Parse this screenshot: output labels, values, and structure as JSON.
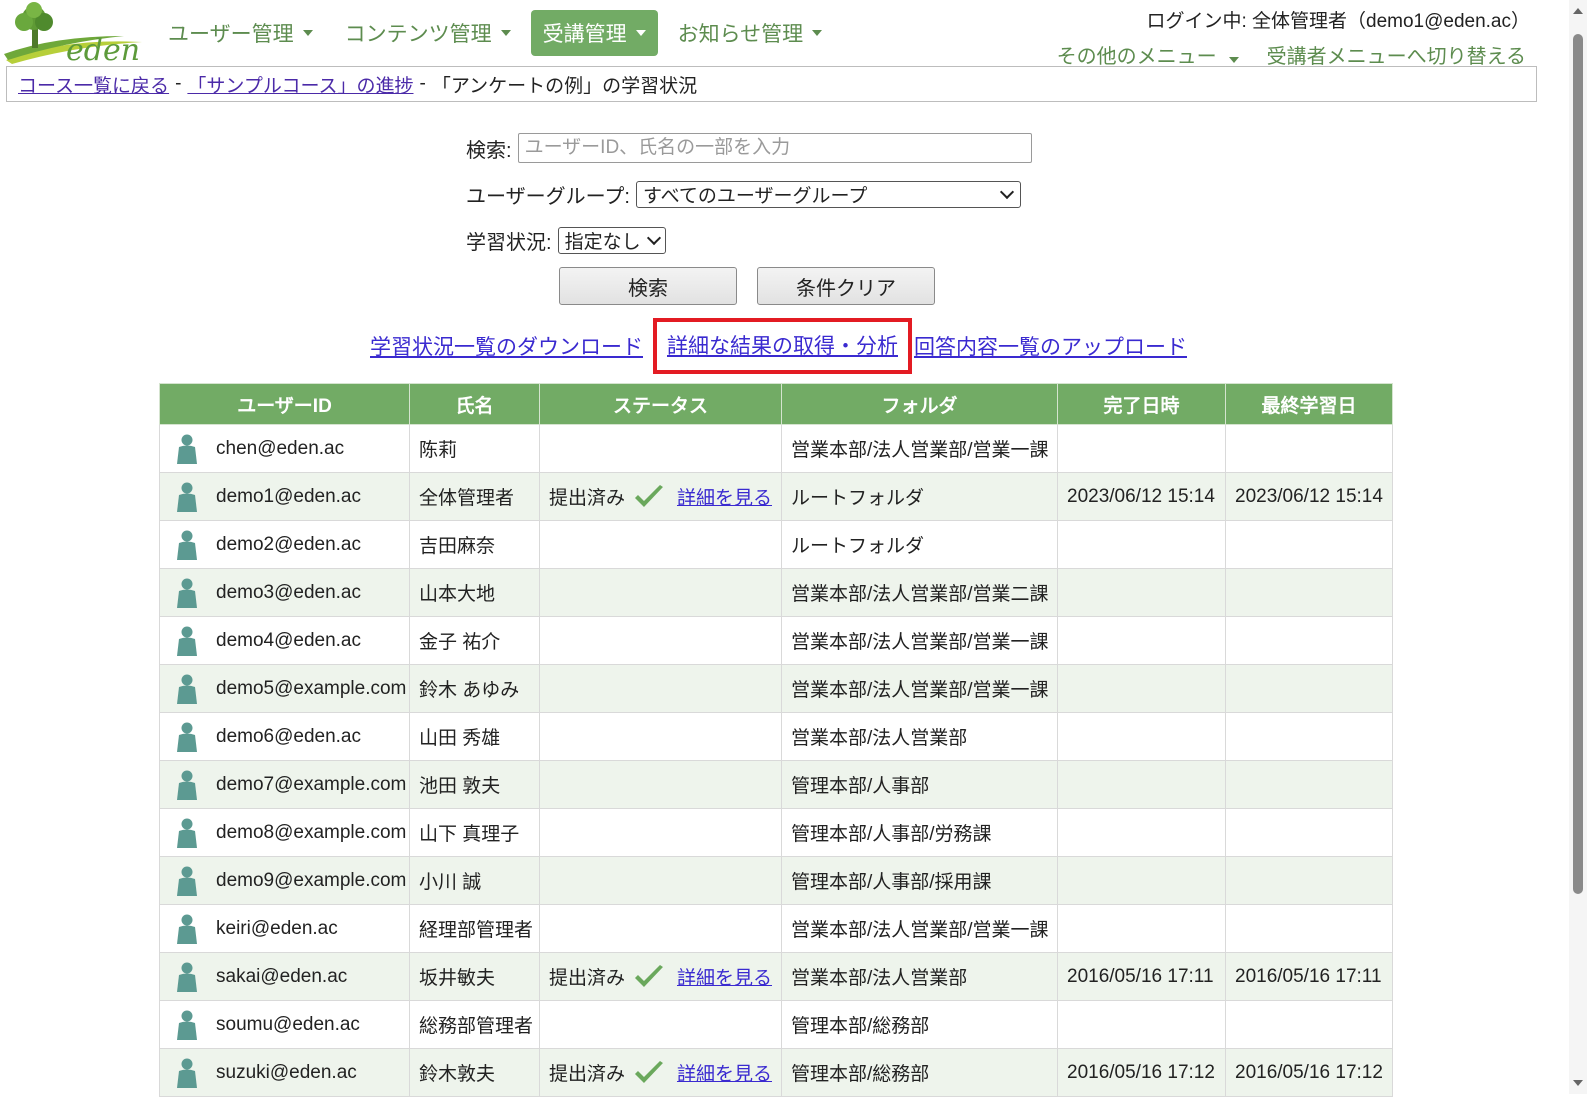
{
  "header": {
    "nav": [
      {
        "label": "ユーザー管理",
        "active": false
      },
      {
        "label": "コンテンツ管理",
        "active": false
      },
      {
        "label": "受講管理",
        "active": true
      },
      {
        "label": "お知らせ管理",
        "active": false
      }
    ],
    "login_text": "ログイン中: 全体管理者（demo1@eden.ac）",
    "other_menu": "その他のメニュー",
    "switch_menu": "受講者メニューへ切り替える"
  },
  "breadcrumb": {
    "back_link": "コース一覧に戻る",
    "sep": "-",
    "progress_link": "「サンプルコース」の進捗",
    "current": "「アンケートの例」の学習状況"
  },
  "search": {
    "label": "検索:",
    "placeholder": "ユーザーID、氏名の一部を入力",
    "group_label": "ユーザーグループ:",
    "group_value": "すべてのユーザーグループ",
    "status_label": "学習状況:",
    "status_value": "指定なし",
    "search_button": "検索",
    "clear_button": "条件クリア"
  },
  "links": {
    "download": "学習状況一覧のダウンロード",
    "analysis": "詳細な結果の取得・分析",
    "upload": "回答内容一覧のアップロード"
  },
  "table": {
    "headers": [
      "ユーザーID",
      "氏名",
      "ステータス",
      "フォルダ",
      "完了日時",
      "最終学習日"
    ],
    "rows": [
      {
        "id": "chen@eden.ac",
        "name": "陈莉",
        "status": "",
        "detail": "",
        "folder": "営業本部/法人営業部/営業一課",
        "done": "",
        "last": ""
      },
      {
        "id": "demo1@eden.ac",
        "name": "全体管理者",
        "status": "提出済み",
        "detail": "詳細を見る",
        "folder": "ルートフォルダ",
        "done": "2023/06/12 15:14",
        "last": "2023/06/12 15:14"
      },
      {
        "id": "demo2@eden.ac",
        "name": "吉田麻奈",
        "status": "",
        "detail": "",
        "folder": "ルートフォルダ",
        "done": "",
        "last": ""
      },
      {
        "id": "demo3@eden.ac",
        "name": "山本大地",
        "status": "",
        "detail": "",
        "folder": "営業本部/法人営業部/営業二課",
        "done": "",
        "last": ""
      },
      {
        "id": "demo4@eden.ac",
        "name": "金子 祐介",
        "status": "",
        "detail": "",
        "folder": "営業本部/法人営業部/営業一課",
        "done": "",
        "last": ""
      },
      {
        "id": "demo5@example.com",
        "name": "鈴木 あゆみ",
        "status": "",
        "detail": "",
        "folder": "営業本部/法人営業部/営業一課",
        "done": "",
        "last": ""
      },
      {
        "id": "demo6@eden.ac",
        "name": "山田 秀雄",
        "status": "",
        "detail": "",
        "folder": "営業本部/法人営業部",
        "done": "",
        "last": ""
      },
      {
        "id": "demo7@example.com",
        "name": "池田 敦夫",
        "status": "",
        "detail": "",
        "folder": "管理本部/人事部",
        "done": "",
        "last": ""
      },
      {
        "id": "demo8@example.com",
        "name": "山下 真理子",
        "status": "",
        "detail": "",
        "folder": "管理本部/人事部/労務課",
        "done": "",
        "last": ""
      },
      {
        "id": "demo9@example.com",
        "name": "小川 誠",
        "status": "",
        "detail": "",
        "folder": "管理本部/人事部/採用課",
        "done": "",
        "last": ""
      },
      {
        "id": "keiri@eden.ac",
        "name": "経理部管理者",
        "status": "",
        "detail": "",
        "folder": "営業本部/法人営業部/営業一課",
        "done": "",
        "last": ""
      },
      {
        "id": "sakai@eden.ac",
        "name": "坂井敏夫",
        "status": "提出済み",
        "detail": "詳細を見る",
        "folder": "営業本部/法人営業部",
        "done": "2016/05/16 17:11",
        "last": "2016/05/16 17:11"
      },
      {
        "id": "soumu@eden.ac",
        "name": "総務部管理者",
        "status": "",
        "detail": "",
        "folder": "管理本部/総務部",
        "done": "",
        "last": ""
      },
      {
        "id": "suzuki@eden.ac",
        "name": "鈴木敦夫",
        "status": "提出済み",
        "detail": "詳細を見る",
        "folder": "管理本部/総務部",
        "done": "2016/05/16 17:12",
        "last": "2016/05/16 17:12"
      }
    ]
  },
  "colors": {
    "accent": "#72ab65",
    "highlight": "#e31b23",
    "link": "#3a2ad0"
  }
}
